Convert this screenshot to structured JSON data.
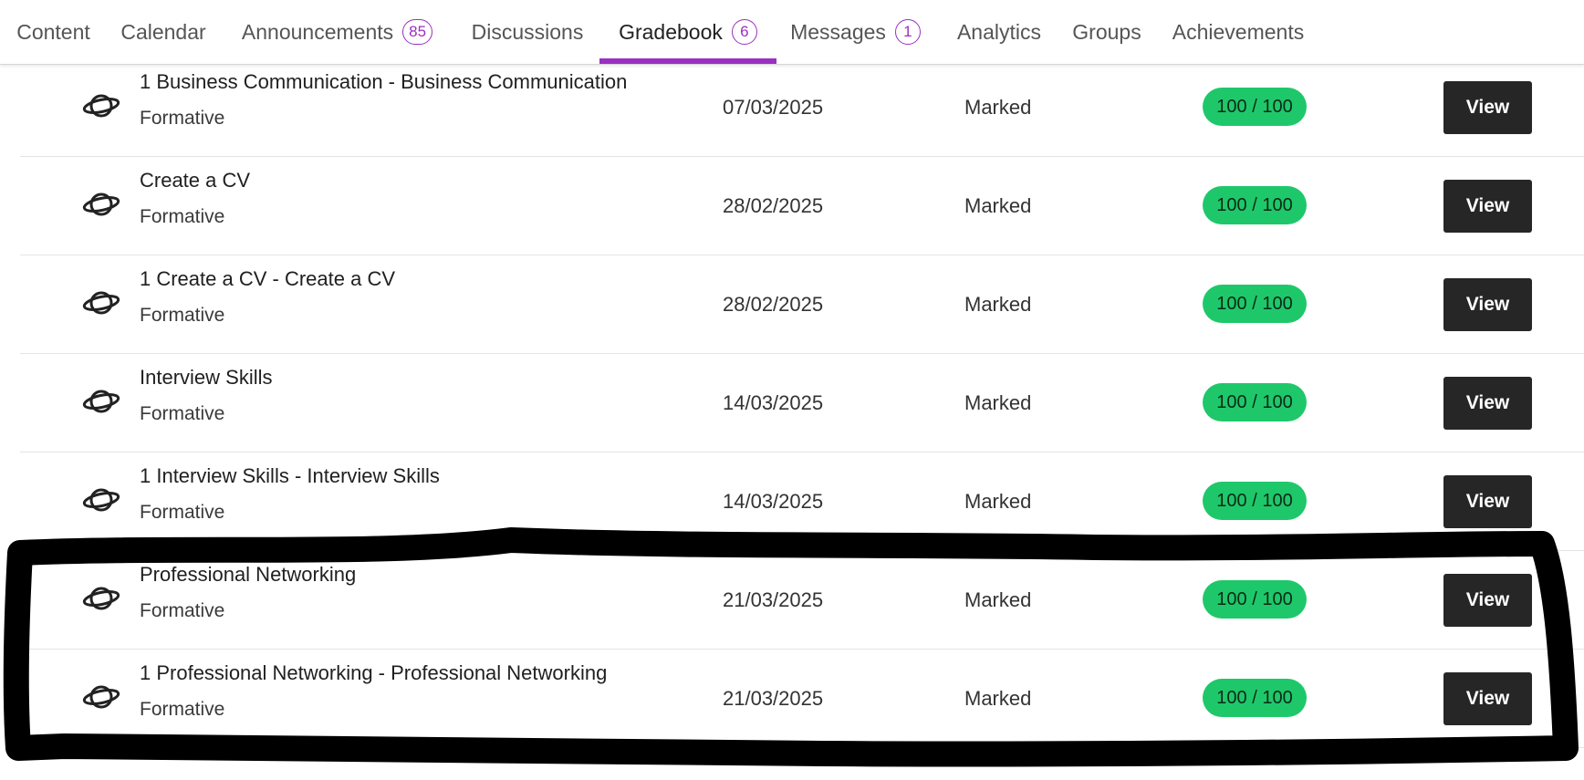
{
  "tabs": [
    {
      "label": "Content"
    },
    {
      "label": "Calendar"
    },
    {
      "label": "Announcements",
      "badge": "85"
    },
    {
      "label": "Discussions"
    },
    {
      "label": "Gradebook",
      "badge": "6"
    },
    {
      "label": "Messages",
      "badge": "1"
    },
    {
      "label": "Analytics"
    },
    {
      "label": "Groups"
    },
    {
      "label": "Achievements"
    }
  ],
  "active_tab": "Gradebook",
  "accent_color": "#9b30c0",
  "score_color": "#1ec86a",
  "rows": [
    {
      "title": "1 Business Communication - Business Communication",
      "type": "Formative",
      "date": "07/03/2025",
      "status": "Marked",
      "score": "100 / 100",
      "action": "View"
    },
    {
      "title": "Create a CV",
      "type": "Formative",
      "date": "28/02/2025",
      "status": "Marked",
      "score": "100 / 100",
      "action": "View"
    },
    {
      "title": "1 Create a CV - Create a CV",
      "type": "Formative",
      "date": "28/02/2025",
      "status": "Marked",
      "score": "100 / 100",
      "action": "View"
    },
    {
      "title": "Interview Skills",
      "type": "Formative",
      "date": "14/03/2025",
      "status": "Marked",
      "score": "100 / 100",
      "action": "View"
    },
    {
      "title": "1 Interview Skills - Interview Skills",
      "type": "Formative",
      "date": "14/03/2025",
      "status": "Marked",
      "score": "100 / 100",
      "action": "View"
    },
    {
      "title": "Professional Networking",
      "type": "Formative",
      "date": "21/03/2025",
      "status": "Marked",
      "score": "100 / 100",
      "action": "View"
    },
    {
      "title": "1 Professional Networking - Professional Networking",
      "type": "Formative",
      "date": "21/03/2025",
      "status": "Marked",
      "score": "100 / 100",
      "action": "View"
    }
  ]
}
